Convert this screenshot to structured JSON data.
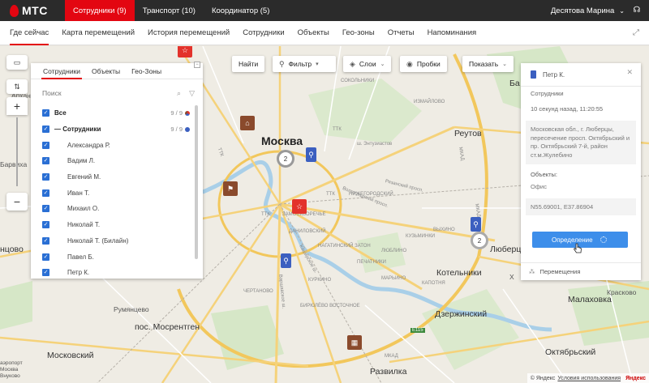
{
  "brand": {
    "logo_text": "МТС",
    "accent": "#e30611"
  },
  "topbar": {
    "tabs": [
      {
        "label": "Сотрудники (9)",
        "active": true
      },
      {
        "label": "Транспорт (10)",
        "active": false
      },
      {
        "label": "Координатор (5)",
        "active": false
      }
    ],
    "user": "Десятова Марина"
  },
  "subnav": {
    "tabs": [
      {
        "label": "Где сейчас",
        "active": true
      },
      {
        "label": "Карта перемещений"
      },
      {
        "label": "История перемещений"
      },
      {
        "label": "Сотрудники"
      },
      {
        "label": "Объекты"
      },
      {
        "label": "Гео-зоны"
      },
      {
        "label": "Отчеты"
      },
      {
        "label": "Напоминания"
      }
    ]
  },
  "toolbar": {
    "find": "Найти",
    "filter": "Фильтр",
    "layers": "Слои",
    "traffic": "Пробки",
    "show": "Показать"
  },
  "left_panel": {
    "tabs": [
      "Сотрудники",
      "Объекты",
      "Гео-Зоны"
    ],
    "search_placeholder": "Поиск",
    "all_label": "Все",
    "all_count": "9 / 9",
    "group_label": "— Сотрудники",
    "group_count": "9 / 9",
    "employees": [
      "Александра Р.",
      "Вадим Л.",
      "Евгений М.",
      "Иван Т.",
      "Михаил О.",
      "Николай Т.",
      "Николай Т. (Билайн)",
      "Павел Б.",
      "Петр К."
    ]
  },
  "right_card": {
    "name": "Петр К.",
    "role": "Сотрудники",
    "time": "10 секунд назад, 11:20:55",
    "address": "Московская обл., г. Люберцы, пересечение просп. Октябрьский и пр. Октябрьский 7-й, район ст.м.Жулебино",
    "objects_label": "Объекты:",
    "object_value": "Офис",
    "coords": "N55.69001, E37.86904",
    "button": "Определение",
    "footer": "Перемещения"
  },
  "map": {
    "labels": {
      "moscow": "Москва",
      "reutov": "Реутов",
      "kotelniki": "Котельники",
      "lyubertsy": "Люберцы",
      "dzerzhinsky": "Дзержинский",
      "rumyantsevo": "Румянцево",
      "mosrentgen": "пос. Мосрентген",
      "moskovsky": "Московский",
      "razvilka": "Развилка",
      "malakhovka": "Малаховка",
      "oktyabrsky": "Октябрьский",
      "kraskovo": "Красково",
      "airport": "аэропорт Москва Внуково",
      "arkhangelskoe": "Арханг",
      "barvikha": "Барвиха",
      "odintsovo": "нцово",
      "ba": "Ба",
      "kh": "Х",
      "sokolniki": "СОКОЛЬНИКИ",
      "izmaylovo": "ИЗМАЙЛОВО",
      "zamoskvorechye": "ЗАМОСКВОРЕЧЬЕ",
      "nagatinsky": "НАГАТИНСКИЙ ЗАТОН",
      "pechatniki": "ПЕЧАТНИКИ",
      "danilovsky": "ДАНИЛОВСКИЙ",
      "nizhegorodsky": "НИЖЕГОРОДСКИЙ",
      "kuzminki": "КУЗЬМИНКИ",
      "vykhino": "ВЫХИНО",
      "lublino": "ЛЮБЛИНО",
      "maryino": "МАРЬИНО",
      "kapotnya": "КАПОТНЯ",
      "biryulyovo": "БИРЮЛЁВО ВОСТОЧНОЕ",
      "kurkino": "КУРКИНО",
      "chertanovo": "ЧЕРТАНОВО",
      "enthusiasts": "ш. Энтузиастов",
      "volgogradsky": "Волгоградский просп.",
      "ryazansky": "Рязанский просп.",
      "varshavskoe": "Варшавское ш.",
      "kashirskoe": "Каширское ш.",
      "mkad1": "МКАД",
      "mkad2": "МКАД",
      "mkad3": "МКАД",
      "e115": "E115",
      "ttk1": "ТТК",
      "ttk2": "ТТК",
      "ttk3": "ТТК",
      "ttk4": "ТТК"
    },
    "clusters": [
      "2",
      "2"
    ],
    "copyright_prefix": "© Яндекс",
    "terms": "Условия использования",
    "yandex": "Яндекс"
  }
}
